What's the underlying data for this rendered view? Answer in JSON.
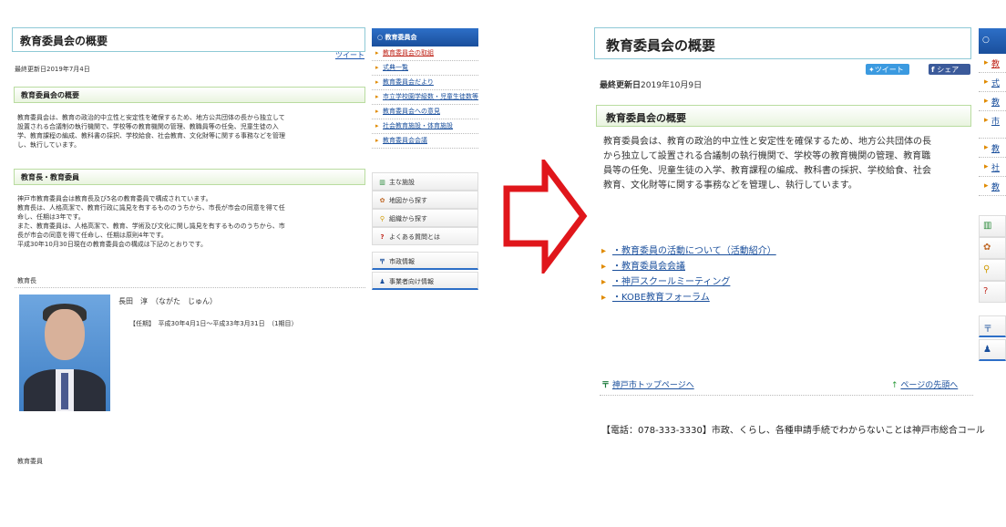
{
  "before": {
    "title": "教育委員会の概要",
    "tweet_label": "ツイート",
    "updated": "最終更新日2019年7月4日",
    "section1": {
      "heading": "教育委員会の概要",
      "lines": [
        "教育委員会は、教育の政治的中立性と安定性を確保するため、地方公共団体の長から独立して",
        "設置される合議制の執行機関で、学校等の教育機関の管理、教職員等の任免、児童生徒の入",
        "学、教育課程の編成、教科書の採択、学校給食、社会教育、文化財等に関する事務などを管理",
        "し、執行しています。"
      ]
    },
    "section2": {
      "heading": "教育長・教育委員",
      "lines": [
        "神戸市教育委員会は教育長及び5名の教育委員で構成されています。",
        "教育長は、人格高潔で、教育行政に識見を有するもののうちから、市長が市会の同意を得て任",
        "命し、任期は3年です。",
        "また、教育委員は、人格高潔で、教育、学術及び文化に関し識見を有するもののうちから、市",
        "長が市会の同意を得て任命し、任期は原則4年です。",
        "平成30年10月30日現在の教育委員会の構成は下記のとおりです。"
      ]
    },
    "kyoikucho_label": "教育長",
    "person_name": "長田　淳　（ながた　じゅん）",
    "person_term": "【任期】　平成30年4月1日～平成33年3月31日　（1期目）",
    "iinkai_label": "教育委員",
    "sidebar": {
      "heading": "教育委員会",
      "items": [
        "教育委員会の取組",
        "式典一覧",
        "教育委員会だより",
        "市立学校園学級数・児童生徒数等",
        "教育委員会への意見",
        "社会教育施設・体育施設",
        "教育委員会会議"
      ]
    },
    "menus": [
      {
        "icon": "▥",
        "label": "主な施設"
      },
      {
        "icon": "✿",
        "label": "地図から探す"
      },
      {
        "icon": "⚲",
        "label": "組織から探す"
      },
      {
        "icon": "?",
        "label": "よくある質問とは"
      },
      {
        "icon": "〒",
        "label": "市政情報"
      },
      {
        "icon": "♟",
        "label": "事業者向け情報"
      }
    ]
  },
  "after": {
    "title": "教育委員会の概要",
    "tweet_label": "ツイート",
    "share_label": "シェア",
    "updated_label": "最終更新日",
    "updated_date": "2019年10月9日",
    "section1": {
      "heading": "教育委員会の概要",
      "lines": [
        "教育委員会は、教育の政治的中立性と安定性を確保するため、地方公共団体の長",
        "から独立して設置される合議制の執行機関で、学校等の教育機関の管理、教育職",
        "員等の任免、児童生徒の入学、教育課程の編成、教科書の採択、学校給食、社会",
        "教育、文化財等に関する事務などを管理し、執行しています。"
      ]
    },
    "links": [
      "・教育委員の活動について（活動紹介）",
      "・教育委員会会議",
      "・神戸スクールミーティング",
      "・KOBE教育フォーラム"
    ],
    "footer_top_link": "神戸市トップページへ",
    "footer_page_top": "ページの先頭へ",
    "phone_notice": "【電話：078-333-3330】市政、くらし、各種申請手続でわからないことは神戸市総合コール",
    "sidebar": {
      "heading": "○",
      "items": [
        "教",
        "式",
        "教",
        "市",
        "教",
        "社",
        "教"
      ]
    },
    "menus": [
      "▥",
      "✿",
      "⚲",
      "?",
      "〒",
      "♟"
    ]
  },
  "colors": {
    "accent_blue": "#1a4f9c",
    "arrow_red": "#e0161b",
    "link_orange": "#e08a00"
  }
}
